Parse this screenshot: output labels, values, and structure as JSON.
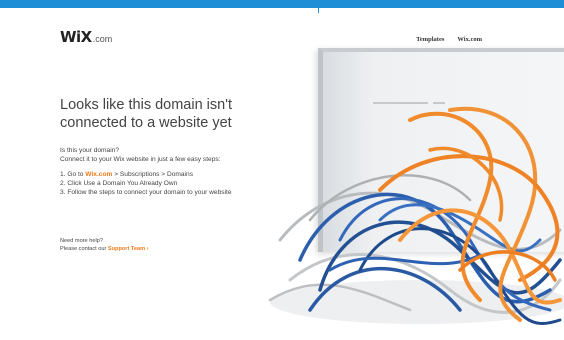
{
  "header": {
    "logo_main": "WiX",
    "logo_suffix": ".com",
    "nav": [
      {
        "label": "Templates"
      },
      {
        "label": "Wix.com"
      }
    ]
  },
  "main": {
    "headline": "Looks like this domain isn't connected to a website yet",
    "intro_line1": "Is this your domain?",
    "intro_line2": "Connect it to your Wix website in just a few easy steps:",
    "step1_prefix": "1. Go to ",
    "step1_link": "Wix.com",
    "step1_suffix": " > Subscriptions > Domains",
    "step2": "2. Click Use a Domain You Already Own",
    "step3": "3. Follow the steps to connect your domain to your website"
  },
  "help": {
    "line1": "Need more help?",
    "line2_prefix": "Please contact our ",
    "link": "Support Team ›"
  },
  "colors": {
    "topbar": "#1e8fd6",
    "accent": "#f07a1a",
    "cable_blue": "#2b5fae",
    "cable_orange": "#f08a2a",
    "cable_gray": "#b9bcbf"
  }
}
